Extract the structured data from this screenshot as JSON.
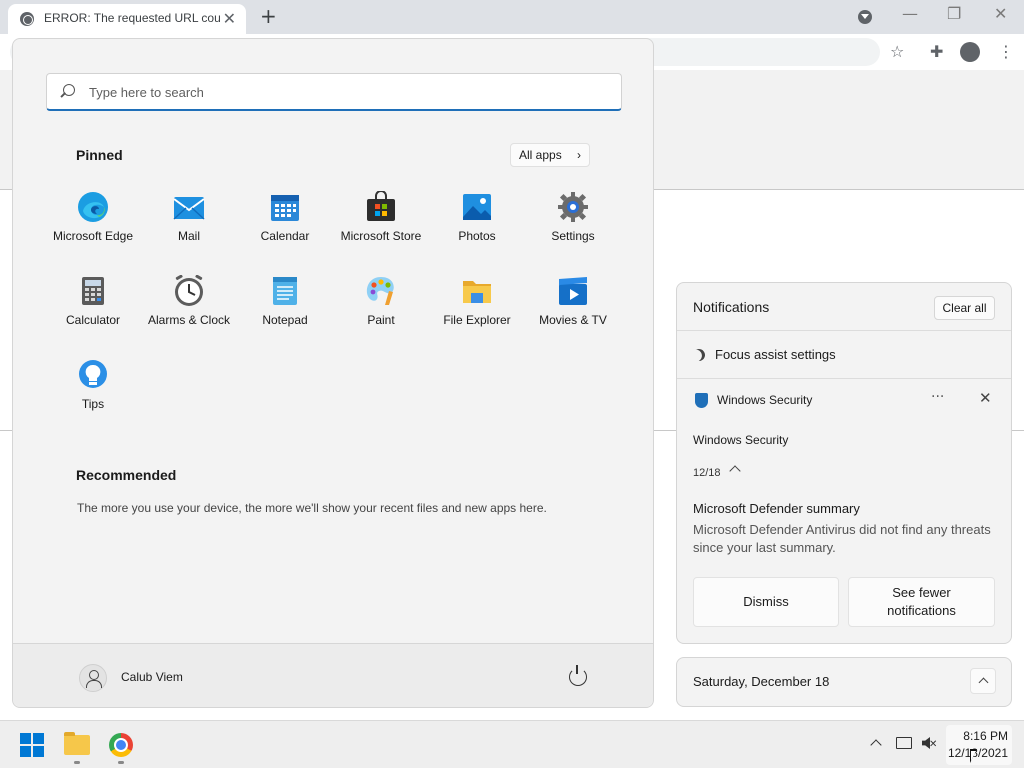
{
  "browser": {
    "tab_title": "ERROR: The requested URL could not be retrieved",
    "tab_close": "✕",
    "new_tab": "+",
    "minimize": "—",
    "restore": "❐",
    "close": "✕",
    "bookmark_icon": "☆",
    "extensions_icon": "✚",
    "menu_icon": "⋮"
  },
  "start_menu": {
    "search_placeholder": "Type here to search",
    "pinned_title": "Pinned",
    "all_apps_label": "All apps",
    "all_apps_chevron": "›",
    "pinned_apps": [
      {
        "label": "Microsoft Edge",
        "icon": "edge-icon"
      },
      {
        "label": "Mail",
        "icon": "mail-icon"
      },
      {
        "label": "Calendar",
        "icon": "calendar-icon"
      },
      {
        "label": "Microsoft Store",
        "icon": "store-icon"
      },
      {
        "label": "Photos",
        "icon": "photos-icon"
      },
      {
        "label": "Settings",
        "icon": "settings-icon"
      },
      {
        "label": "Calculator",
        "icon": "calculator-icon"
      },
      {
        "label": "Alarms & Clock",
        "icon": "clock-icon"
      },
      {
        "label": "Notepad",
        "icon": "notepad-icon"
      },
      {
        "label": "Paint",
        "icon": "paint-icon"
      },
      {
        "label": "File Explorer",
        "icon": "folder-icon"
      },
      {
        "label": "Movies & TV",
        "icon": "movies-icon"
      },
      {
        "label": "Tips",
        "icon": "tips-icon"
      }
    ],
    "recommended_title": "Recommended",
    "recommended_text": "The more you use your device, the more we'll show your recent files and new apps here.",
    "user_name": "Calub Viem"
  },
  "notifications": {
    "title": "Notifications",
    "clear_all": "Clear all",
    "focus_assist": "Focus assist settings",
    "app_name": "Windows Security",
    "more": "···",
    "close": "✕",
    "subtitle": "Windows Security",
    "date": "12/18",
    "heading": "Microsoft Defender summary",
    "body": "Microsoft Defender Antivirus did not find any threats since your last summary.",
    "dismiss": "Dismiss",
    "see_fewer": "See fewer notifications"
  },
  "calendar": {
    "date_label": "Saturday, December 18"
  },
  "taskbar": {
    "time": "8:16 PM",
    "date": "12/18/2021"
  }
}
